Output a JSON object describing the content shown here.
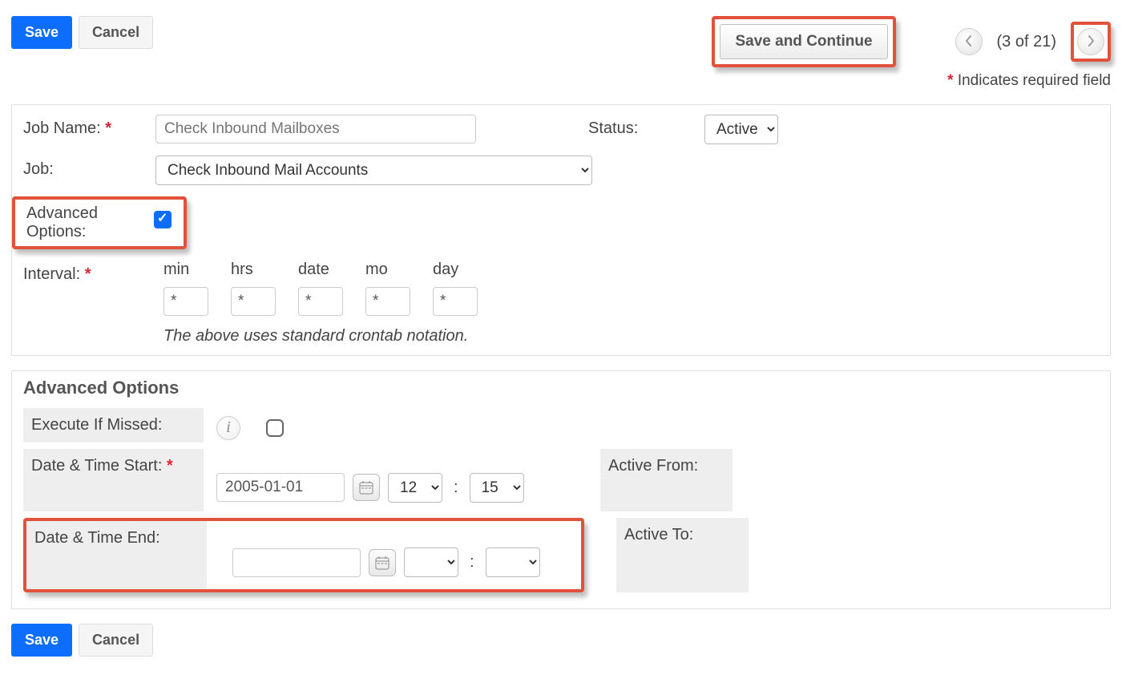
{
  "buttons": {
    "save": "Save",
    "cancel": "Cancel",
    "save_continue": "Save and Continue"
  },
  "pager": {
    "text": "(3 of 21)"
  },
  "required_note": {
    "ast": "*",
    "text": " Indicates required field"
  },
  "labels": {
    "job_name": "Job Name:",
    "job": "Job:",
    "status": "Status:",
    "advanced_options_chk": "Advanced Options:",
    "interval": "Interval:"
  },
  "fields": {
    "job_name_placeholder": "Check Inbound Mailboxes",
    "status_selected": "Active",
    "job_selected": "Check Inbound Mail Accounts"
  },
  "interval": {
    "min_label": "min",
    "hrs_label": "hrs",
    "date_label": "date",
    "mo_label": "mo",
    "day_label": "day",
    "min": "*",
    "hrs": "*",
    "date": "*",
    "mo": "*",
    "day": "*",
    "note": "The above uses standard crontab notation."
  },
  "adv": {
    "header": "Advanced Options",
    "execute_if_missed": "Execute If Missed:",
    "date_start": "Date & Time Start:",
    "date_end": "Date & Time End:",
    "active_from": "Active From:",
    "active_to": "Active To:",
    "start_date": "2005-01-01",
    "start_hour": "12",
    "start_min": "15",
    "end_date": "",
    "end_hour": "",
    "end_min": ""
  },
  "ast": "*"
}
